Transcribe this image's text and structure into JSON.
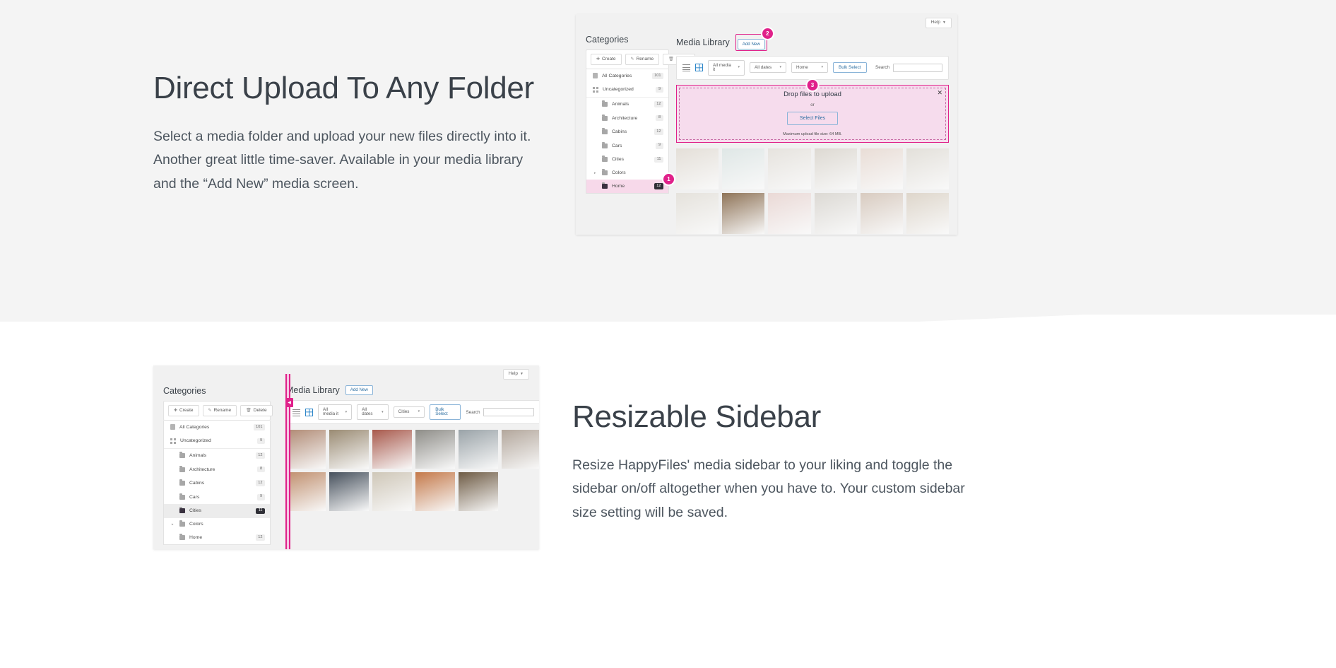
{
  "sections": [
    {
      "title": "Direct Upload To Any Folder",
      "body": "Select a media folder and upload your new files directly into it. Another great little time-saver. Available in your media library and the “Add New” media screen."
    },
    {
      "title": "Resizable Sidebar",
      "body": "Resize HappyFiles' media sidebar to your liking and toggle the sidebar on/off altogether when you have to. Your custom sidebar size setting will be saved."
    }
  ],
  "mockup1": {
    "help_label": "Help",
    "categories_title": "Categories",
    "actions": [
      {
        "label": "Create",
        "icon": "plus-circle-icon"
      },
      {
        "label": "Rename",
        "icon": "pencil-icon"
      },
      {
        "label": "Delete",
        "icon": "trash-icon"
      }
    ],
    "category_rows": [
      {
        "label": "All Categories",
        "count": "101",
        "icon": "document-icon",
        "indent": false,
        "state": "normal"
      },
      {
        "label": "Uncategorized",
        "count": "9",
        "icon": "grid-icon",
        "indent": false,
        "state": "normal"
      },
      {
        "label": "Animals",
        "count": "12",
        "icon": "folder-icon",
        "indent": true,
        "state": "normal"
      },
      {
        "label": "Architecture",
        "count": "8",
        "icon": "folder-icon",
        "indent": true,
        "state": "normal"
      },
      {
        "label": "Cabins",
        "count": "12",
        "icon": "folder-icon",
        "indent": true,
        "state": "normal"
      },
      {
        "label": "Cars",
        "count": "9",
        "icon": "folder-icon",
        "indent": true,
        "state": "normal"
      },
      {
        "label": "Cities",
        "count": "11",
        "icon": "folder-icon",
        "indent": true,
        "state": "normal"
      },
      {
        "label": "Colors",
        "count": "",
        "icon": "folder-icon",
        "indent": true,
        "state": "normal",
        "twisty": "▸"
      },
      {
        "label": "Home",
        "count": "12",
        "icon": "folder-icon",
        "indent": true,
        "state": "selected"
      }
    ],
    "media_title": "Media Library",
    "add_new_label": "Add New",
    "toolbar": {
      "media_filter": "All media it",
      "dates_filter": "All dates",
      "folder_filter": "Home",
      "bulk_select_label": "Bulk Select",
      "search_label": "Search",
      "search_value": ""
    },
    "dropzone": {
      "title": "Drop files to upload",
      "or_label": "or",
      "select_files_label": "Select Files",
      "max_size_note": "Maximum upload file size: 64 MB.",
      "close_icon": "close-icon"
    },
    "markers": [
      {
        "number": "1"
      },
      {
        "number": "2"
      },
      {
        "number": "3"
      }
    ],
    "thumb_colors": [
      [
        "#e4dfd8",
        "#dfe7e6",
        "#e6e3de",
        "#ddd9d2",
        "#e9ddd6",
        "#e3e0da"
      ],
      [
        "#e5e2dc",
        "#8f7458",
        "#ead9d6",
        "#dcd9d4",
        "#d8cbc0",
        "#ded6cb"
      ]
    ]
  },
  "mockup2": {
    "help_label": "Help",
    "categories_title": "Categories",
    "actions": [
      {
        "label": "Create",
        "icon": "plus-circle-icon"
      },
      {
        "label": "Rename",
        "icon": "pencil-icon"
      },
      {
        "label": "Delete",
        "icon": "trash-icon"
      }
    ],
    "category_rows": [
      {
        "label": "All Categories",
        "count": "101",
        "icon": "document-icon",
        "indent": false,
        "state": "normal"
      },
      {
        "label": "Uncategorized",
        "count": "9",
        "icon": "grid-icon",
        "indent": false,
        "state": "normal"
      },
      {
        "label": "Animals",
        "count": "12",
        "icon": "folder-icon",
        "indent": true,
        "state": "normal"
      },
      {
        "label": "Architecture",
        "count": "8",
        "icon": "folder-icon",
        "indent": true,
        "state": "normal"
      },
      {
        "label": "Cabins",
        "count": "12",
        "icon": "folder-icon",
        "indent": true,
        "state": "normal"
      },
      {
        "label": "Cars",
        "count": "9",
        "icon": "folder-icon",
        "indent": true,
        "state": "normal"
      },
      {
        "label": "Cities",
        "count": "11",
        "icon": "folder-icon",
        "indent": true,
        "state": "selected"
      },
      {
        "label": "Colors",
        "count": "",
        "icon": "folder-icon",
        "indent": true,
        "state": "normal",
        "twisty": "▸"
      },
      {
        "label": "Home",
        "count": "12",
        "icon": "folder-icon",
        "indent": true,
        "state": "normal"
      }
    ],
    "media_title": "Media Library",
    "add_new_label": "Add New",
    "toolbar": {
      "media_filter": "All media it",
      "dates_filter": "All dates",
      "folder_filter": "Cities",
      "bulk_select_label": "Bulk Select",
      "search_label": "Search",
      "search_value": ""
    },
    "resize_handle_icon": "collapse-left-icon",
    "thumb_colors": [
      [
        "#b08a74",
        "#9a8b73",
        "#a8594c",
        "#8e8d88",
        "#9aa3a8",
        "#b3a79c"
      ],
      [
        "#c08f6e",
        "#46505c",
        "#cfc7b8",
        "#c4794a",
        "#6e5b44"
      ]
    ]
  }
}
